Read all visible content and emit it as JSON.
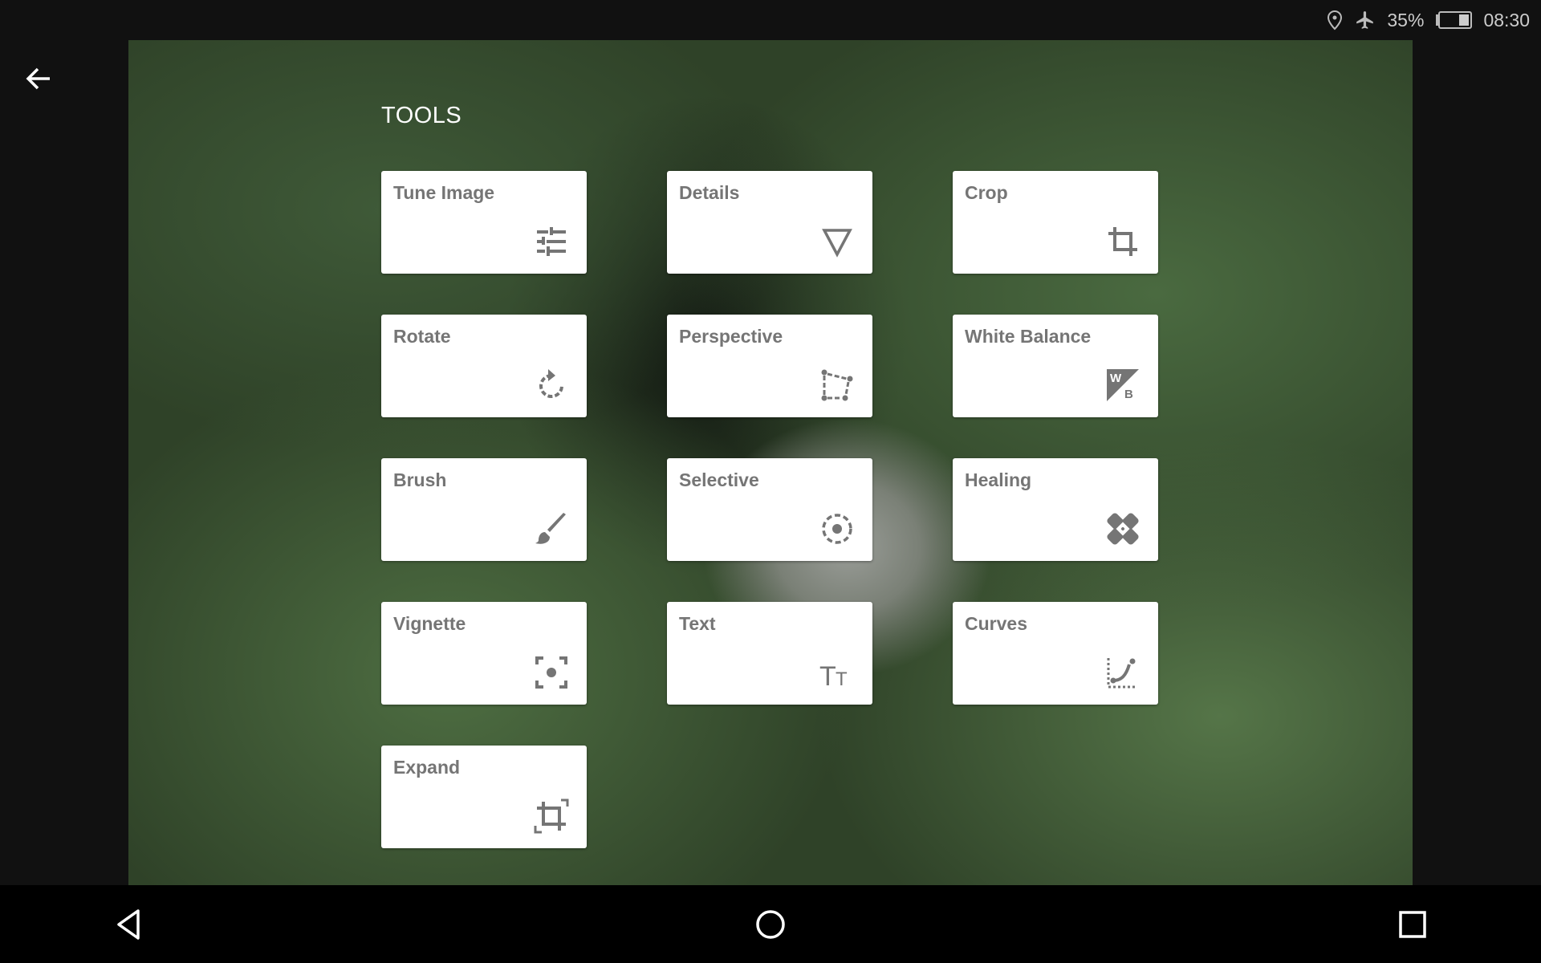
{
  "status_bar": {
    "battery": "35%",
    "time": "08:30",
    "icons": [
      "location-icon",
      "airplane-icon",
      "battery-icon"
    ]
  },
  "header": {
    "title": "TOOLS",
    "back_icon": "arrow-left-icon"
  },
  "tools": [
    {
      "label": "Tune Image",
      "icon": "sliders-icon"
    },
    {
      "label": "Details",
      "icon": "triangle-down-icon"
    },
    {
      "label": "Crop",
      "icon": "crop-icon"
    },
    {
      "label": "Rotate",
      "icon": "rotate-icon"
    },
    {
      "label": "Perspective",
      "icon": "perspective-icon"
    },
    {
      "label": "White Balance",
      "icon": "white-balance-icon"
    },
    {
      "label": "Brush",
      "icon": "brush-icon"
    },
    {
      "label": "Selective",
      "icon": "selective-icon"
    },
    {
      "label": "Healing",
      "icon": "bandage-icon"
    },
    {
      "label": "Vignette",
      "icon": "vignette-icon"
    },
    {
      "label": "Text",
      "icon": "text-icon"
    },
    {
      "label": "Curves",
      "icon": "curves-icon"
    },
    {
      "label": "Expand",
      "icon": "expand-icon"
    }
  ],
  "nav_bar": {
    "icons": [
      "back-triangle-icon",
      "home-circle-icon",
      "recents-square-icon"
    ]
  }
}
